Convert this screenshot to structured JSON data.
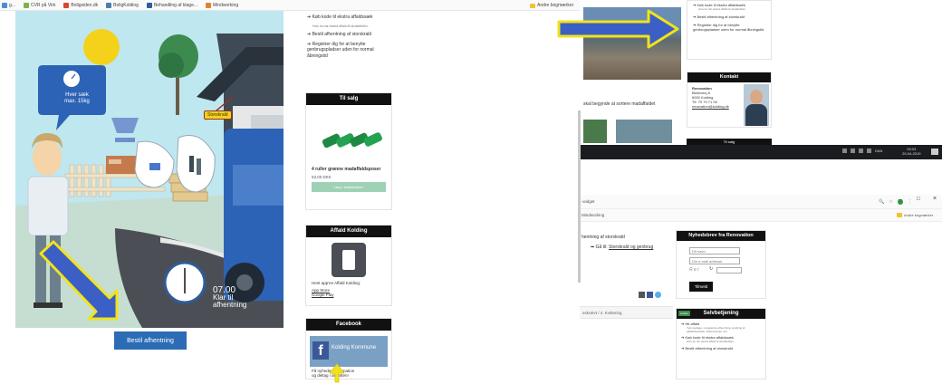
{
  "bookmarks": [
    {
      "label": "g...",
      "color": "#4a8cd6"
    },
    {
      "label": "CVR på Virk",
      "color": "#7fb04a"
    },
    {
      "label": "Boligsiden.dk",
      "color": "#d9482b"
    },
    {
      "label": "BoligKolding",
      "color": "#4a7fb0"
    },
    {
      "label": "Behandling af klage...",
      "color": "#2b5f9c"
    },
    {
      "label": "Mindworking",
      "color": "#e0832e"
    }
  ],
  "other_bookmarks": "Andre bogmærker",
  "illustration": {
    "bubble_text_1": "Hver sæk",
    "bubble_text_2": "max. 15kg",
    "tag": "Storskrald",
    "time": "07.00",
    "time_label_1": "Klar til",
    "time_label_2": "afhentning"
  },
  "order_button": "Bestil afhentning",
  "side_links": [
    {
      "label": "Køb kode til ekstra affaldssæk",
      "sub": "Hvis du har ekstra affald til skraldebilen."
    },
    {
      "label": "Bestil afhentning af storskrald",
      "sub": ""
    },
    {
      "label": "Registrer dig for at benytte genbrugspladser uden for normal åbningstid",
      "sub": ""
    }
  ],
  "sale": {
    "heading": "Til salg",
    "title": "4 ruller grønne madaffaldsposer",
    "price": "53,00 DKK",
    "button": "Læg i indkøbskurv"
  },
  "app": {
    "heading": "Affald Kolding",
    "text": "Hent app'en Affald Kolding:",
    "app_store": "App Store",
    "google_play": "Google Play"
  },
  "facebook": {
    "heading": "Facebook",
    "image_text": "Kolding Kommune",
    "text_1": "Få nyheder, information",
    "text_2": "og deltag i debatten!"
  },
  "right_top": {
    "links": [
      {
        "label": "Køb kode til ekstra affaldssæk",
        "sub": "Hvis du har ekstra affald til skraldebilen."
      },
      {
        "label": "Bestil afhentning af storskrald",
        "sub": ""
      },
      {
        "label": "Registrer dig for at benytte genbrugspladser uden for normal åbningstid",
        "sub": ""
      }
    ],
    "caption": "skal begynde at sortere madaffaldet",
    "contact": {
      "heading": "Kontakt",
      "name": "Renovation",
      "street": "Birkeveej 8",
      "city": "6000 Kolding",
      "phone": "Tlf. 79 79 71 00",
      "email": "renovation@kolding.dk"
    },
    "next_heading": "Til salg"
  },
  "taskbar": {
    "lang": "DAN",
    "time": "09:03",
    "date": "29-04-2019"
  },
  "right_bottom": {
    "tab_text": "-widget",
    "bookmark": "Mindworking",
    "other_bookmarks": "Andre bogmærker",
    "row_text": "hentning af storskrald",
    "goto_text": "Gå til:",
    "goto_link": "Storskrald og genbrug",
    "breadcrumb": "eskrævt  /  4. Kvittering",
    "newsletter": {
      "heading": "Nyhedsbrev fra Renovation",
      "name_placeholder": "Dit navn",
      "email_placeholder": "Din e-mail adresse",
      "captcha": "R e t",
      "submit": "Tilmeld"
    },
    "self_service": {
      "tag": "Lukket",
      "heading": "Selvbetjening",
      "items": [
        {
          "label": "Hit affald",
          "sub": "Tømmedage, manglende afhentning, ændring af affaldsbeholder, klistermærke mm."
        },
        {
          "label": "Køb kode til ekstra affaldssæk",
          "sub": "Hvis du har ekstra affald til skraldebilen."
        },
        {
          "label": "Bestil afhentning af storskrald",
          "sub": ""
        }
      ]
    }
  },
  "colors": {
    "arrow_fill": "#3b5fc4",
    "arrow_outline": "#f2e21a",
    "button": "#2b6cb4",
    "truck": "#2d63b6"
  }
}
